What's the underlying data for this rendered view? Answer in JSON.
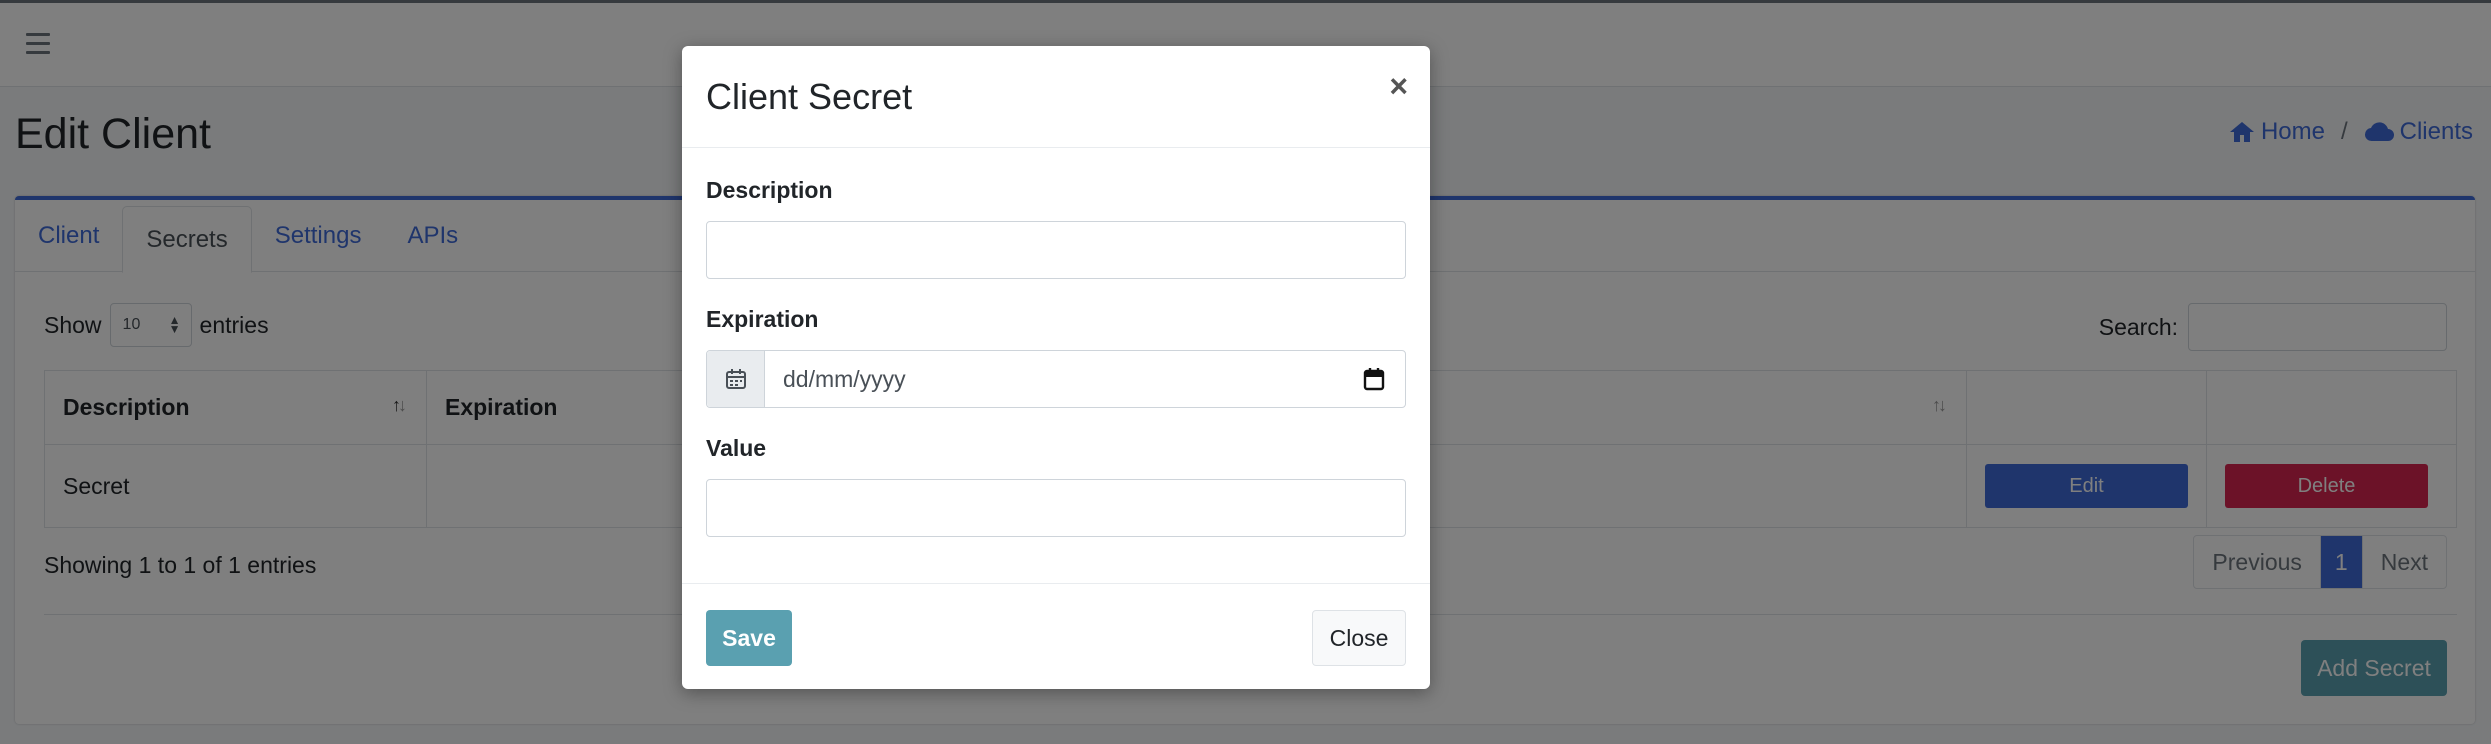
{
  "app": {
    "page_title": "Edit Client",
    "breadcrumb": [
      {
        "label": "Home",
        "icon": "home-icon"
      },
      {
        "label": "Clients",
        "icon": "cloud-icon"
      }
    ],
    "breadcrumb_separator": "/"
  },
  "tabs": [
    {
      "label": "Client",
      "active": false
    },
    {
      "label": "Secrets",
      "active": true
    },
    {
      "label": "Settings",
      "active": false
    },
    {
      "label": "APIs",
      "active": false
    }
  ],
  "table_controls": {
    "show_label": "Show",
    "entries_value": "10",
    "entries_label": "entries",
    "search_label": "Search:"
  },
  "table": {
    "columns": [
      "Description",
      "Expiration"
    ],
    "rows": [
      {
        "description": "Secret",
        "expiration": "",
        "edit_label": "Edit",
        "delete_label": "Delete"
      }
    ]
  },
  "footer": {
    "showing": "Showing 1 to 1 of 1 entries",
    "pager": {
      "previous": "Previous",
      "current": "1",
      "next": "Next"
    },
    "add_button": "Add Secret"
  },
  "modal": {
    "title": "Client Secret",
    "close_symbol": "×",
    "fields": {
      "description_label": "Description",
      "description_value": "",
      "expiration_label": "Expiration",
      "expiration_placeholder": "dd/mm/yyyy",
      "value_label": "Value",
      "value_value": ""
    },
    "save_label": "Save",
    "close_label": "Close"
  },
  "colors": {
    "primary": "#3f6ad8",
    "danger": "#d92550",
    "info": "#5aa0b0"
  }
}
